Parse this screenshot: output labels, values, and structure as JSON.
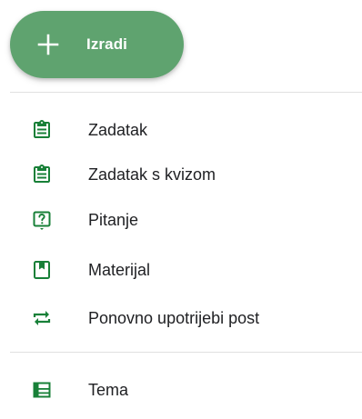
{
  "create_button": {
    "label": "Izradi",
    "icon": "plus-icon",
    "color": "#5fa36f"
  },
  "menu": {
    "items": [
      {
        "label": "Zadatak",
        "icon": "assignment-icon"
      },
      {
        "label": "Zadatak s kvizom",
        "icon": "quiz-assignment-icon"
      },
      {
        "label": "Pitanje",
        "icon": "question-icon"
      },
      {
        "label": "Materijal",
        "icon": "material-icon"
      },
      {
        "label": "Ponovno upotrijebi post",
        "icon": "reuse-post-icon"
      }
    ],
    "topic": {
      "label": "Tema",
      "icon": "topic-icon"
    }
  },
  "colors": {
    "icon_green": "#188038",
    "text": "#202124",
    "divider": "#e0e0e0"
  }
}
